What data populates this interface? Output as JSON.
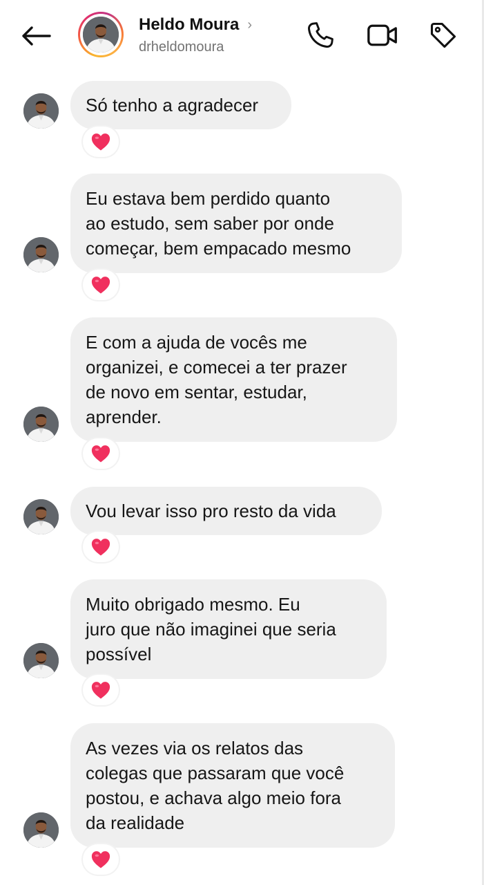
{
  "header": {
    "contact_name": "Heldo Moura",
    "username": "drheldomoura",
    "icons": [
      "back-arrow-icon",
      "chevron-right-icon",
      "phone-icon",
      "video-icon",
      "tag-icon"
    ],
    "chevron": "›",
    "story_ring_colors": [
      "#f9b42d",
      "#e1306c",
      "#c13584"
    ]
  },
  "messages": [
    {
      "text": "Só tenho a agradecer",
      "reaction": "heart"
    },
    {
      "text": "Eu estava bem perdido quanto\nao estudo, sem saber por onde\ncomeçar, bem empacado mesmo",
      "reaction": "heart"
    },
    {
      "text": "E com a ajuda de vocês me\norganizei, e comecei a ter prazer\nde novo em sentar, estudar,\naprender.",
      "reaction": "heart"
    },
    {
      "text": "Vou levar isso pro resto da vida",
      "reaction": "heart"
    },
    {
      "text": "Muito obrigado mesmo. Eu\njuro que não imaginei que seria\npossível",
      "reaction": "heart"
    },
    {
      "text": "As vezes via os relatos das\ncolegas que passaram que você\npostou, e achava algo meio fora\nda realidade",
      "reaction": "heart"
    }
  ],
  "colors": {
    "bubble": "#efefef",
    "heart": "#f0305e",
    "username": "#737373"
  }
}
